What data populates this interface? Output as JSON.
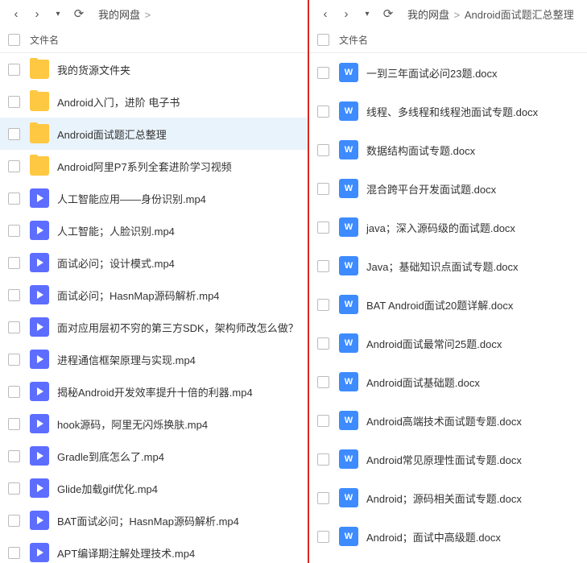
{
  "common": {
    "header_filename": "文件名",
    "crumb_root": "我的网盘",
    "sep": ">"
  },
  "left": {
    "breadcrumb": {
      "current": ""
    },
    "files": [
      {
        "name": "我的货源文件夹",
        "type": "folder",
        "selected": false
      },
      {
        "name": "Android入门，进阶 电子书",
        "type": "folder",
        "selected": false
      },
      {
        "name": "Android面试题汇总整理",
        "type": "folder",
        "selected": true
      },
      {
        "name": "Android阿里P7系列全套进阶学习视频",
        "type": "folder",
        "selected": false
      },
      {
        "name": "人工智能应用——身份识别.mp4",
        "type": "video",
        "selected": false
      },
      {
        "name": "人工智能；人脸识别.mp4",
        "type": "video",
        "selected": false
      },
      {
        "name": "面试必问；设计模式.mp4",
        "type": "video",
        "selected": false
      },
      {
        "name": "面试必问；HasnMap源码解析.mp4",
        "type": "video",
        "selected": false
      },
      {
        "name": "面对应用层初不穷的第三方SDK，架构师改怎么做？",
        "type": "video",
        "selected": false
      },
      {
        "name": "进程通信框架原理与实现.mp4",
        "type": "video",
        "selected": false
      },
      {
        "name": "揭秘Android开发效率提升十倍的利器.mp4",
        "type": "video",
        "selected": false
      },
      {
        "name": "hook源码，阿里无闪烁换肤.mp4",
        "type": "video",
        "selected": false
      },
      {
        "name": "Gradle到底怎么了.mp4",
        "type": "video",
        "selected": false
      },
      {
        "name": "Glide加载gif优化.mp4",
        "type": "video",
        "selected": false
      },
      {
        "name": "BAT面试必问；HasnMap源码解析.mp4",
        "type": "video",
        "selected": false
      },
      {
        "name": "APT编译期注解处理技术.mp4",
        "type": "video",
        "selected": false
      }
    ]
  },
  "right": {
    "breadcrumb": {
      "current": "Android面试题汇总整理"
    },
    "files": [
      {
        "name": "一到三年面试必问23题.docx",
        "type": "word"
      },
      {
        "name": "线程、多线程和线程池面试专题.docx",
        "type": "word"
      },
      {
        "name": "数据结构面试专题.docx",
        "type": "word"
      },
      {
        "name": "混合跨平台开发面试题.docx",
        "type": "word"
      },
      {
        "name": "java；深入源码级的面试题.docx",
        "type": "word"
      },
      {
        "name": "Java；基础知识点面试专题.docx",
        "type": "word"
      },
      {
        "name": "BAT Android面试20题详解.docx",
        "type": "word"
      },
      {
        "name": "Android面试最常问25题.docx",
        "type": "word"
      },
      {
        "name": "Android面试基础题.docx",
        "type": "word"
      },
      {
        "name": "Android高端技术面试题专题.docx",
        "type": "word"
      },
      {
        "name": "Android常见原理性面试专题.docx",
        "type": "word"
      },
      {
        "name": "Android；源码相关面试专题.docx",
        "type": "word"
      },
      {
        "name": "Android；面试中高级题.docx",
        "type": "word"
      }
    ]
  }
}
